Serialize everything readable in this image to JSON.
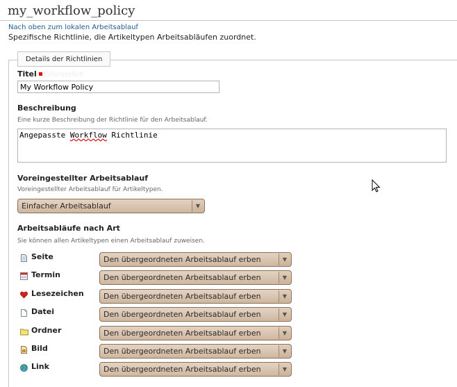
{
  "page": {
    "title": "my_workflow_policy",
    "up_link": "Nach oben zum lokalen Arbeitsablauf",
    "description": "Spezifische Richtlinie, die Artikeltypen Arbeitsabläufen zuordnet."
  },
  "form": {
    "legend": "Details der Richtlinien",
    "title_field": {
      "label": "Titel",
      "required_text": "Erforderlich",
      "value": "My Workflow Policy"
    },
    "description_field": {
      "label": "Beschreibung",
      "help": "Eine kurze Beschreibung der Richtlinie für den Arbeitsablauf.",
      "value_prefix": "Angepasste ",
      "value_misspelled": "Workflow",
      "value_suffix": " Richtlinie"
    },
    "default_workflow": {
      "label": "Voreingestellter Arbeitsablauf",
      "help": "Voreingestellter Arbeitsablauf für Artikeltypen.",
      "selected": "Einfacher Arbeitsablauf"
    },
    "workflows_by_type": {
      "label": "Arbeitsabläufe nach Art",
      "help": "Sie können allen Artikeltypen einen Arbeitsablauf zuweisen.",
      "rows": [
        {
          "type": "Seite",
          "icon": "page-icon",
          "selected": "Den übergeordneten Arbeitsablauf erben"
        },
        {
          "type": "Termin",
          "icon": "calendar-icon",
          "selected": "Den übergeordneten Arbeitsablauf erben"
        },
        {
          "type": "Lesezeichen",
          "icon": "heart-icon",
          "selected": "Den übergeordneten Arbeitsablauf erben"
        },
        {
          "type": "Datei",
          "icon": "file-icon",
          "selected": "Den übergeordneten Arbeitsablauf erben"
        },
        {
          "type": "Ordner",
          "icon": "folder-icon",
          "selected": "Den übergeordneten Arbeitsablauf erben"
        },
        {
          "type": "Bild",
          "icon": "image-icon",
          "selected": "Den übergeordneten Arbeitsablauf erben"
        },
        {
          "type": "Link",
          "icon": "link-globe-icon",
          "selected": "Den übergeordneten Arbeitsablauf erben"
        }
      ]
    }
  },
  "colors": {
    "link": "#205c90",
    "required_marker": "#ee0000",
    "select_bg": "#dcc9b5",
    "select_border": "#8b7058"
  }
}
